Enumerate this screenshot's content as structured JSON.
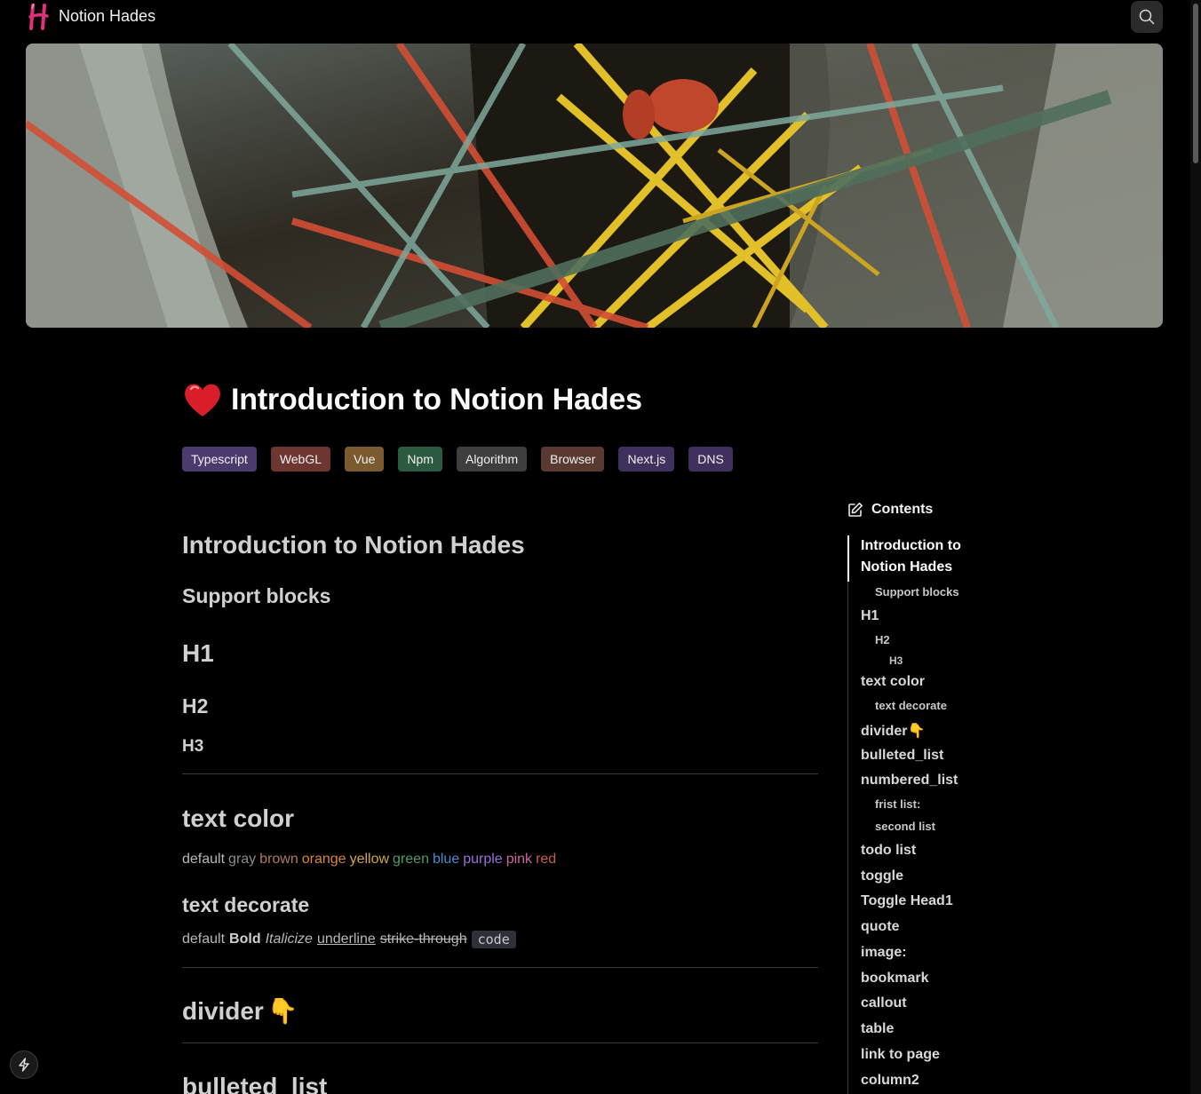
{
  "header": {
    "site_title": "Notion Hades",
    "logo_icon": "hades-h-logo-icon",
    "search_icon": "search-icon"
  },
  "page": {
    "icon": "heart-icon",
    "title": "Introduction to Notion Hades"
  },
  "tags": [
    {
      "label": "Typescript",
      "color": "#4a3a6e"
    },
    {
      "label": "WebGL",
      "color": "#6e3630"
    },
    {
      "label": "Vue",
      "color": "#7a5a2e"
    },
    {
      "label": "Npm",
      "color": "#2c5a41"
    },
    {
      "label": "Algorithm",
      "color": "#3e3e3e"
    },
    {
      "label": "Browser",
      "color": "#5a3a30"
    },
    {
      "label": "Next.js",
      "color": "#40305e"
    },
    {
      "label": "DNS",
      "color": "#40305e"
    }
  ],
  "content": {
    "intro_heading": "Introduction to Notion Hades",
    "support_heading": "Support blocks",
    "h1": "H1",
    "h2": "H2",
    "h3": "H3",
    "text_color_heading": "text color",
    "colors": [
      {
        "label": "default",
        "color": "#b8b8b8"
      },
      {
        "label": "gray",
        "color": "#8a8a8a"
      },
      {
        "label": "brown",
        "color": "#b07a5c"
      },
      {
        "label": "orange",
        "color": "#d9853b"
      },
      {
        "label": "yellow",
        "color": "#d6a73b"
      },
      {
        "label": "green",
        "color": "#4f9a6a"
      },
      {
        "label": "blue",
        "color": "#4b8ad1"
      },
      {
        "label": "purple",
        "color": "#9a6fd6"
      },
      {
        "label": "pink",
        "color": "#c9679c"
      },
      {
        "label": "red",
        "color": "#c65a4c"
      }
    ],
    "text_decorate_heading": "text decorate",
    "decorate": {
      "default": "default",
      "bold": "Bold",
      "italic": "Italicize",
      "underline": "underline",
      "strike": "strike-through",
      "code": "code"
    },
    "divider_heading": "divider",
    "divider_emoji": "👇",
    "bulleted_heading": "bulleted_list"
  },
  "toc": {
    "title": "Contents",
    "title_icon": "edit-icon",
    "items": [
      {
        "label": "Introduction to Notion Hades",
        "level": 1
      },
      {
        "label": "Support blocks",
        "level": 2
      },
      {
        "label": "H1",
        "level": 1
      },
      {
        "label": "H2",
        "level": 2
      },
      {
        "label": "H3",
        "level": 3
      },
      {
        "label": "text color",
        "level": 1
      },
      {
        "label": "text decorate",
        "level": 2
      },
      {
        "label": "divider👇",
        "level": 1
      },
      {
        "label": "bulleted_list",
        "level": 1
      },
      {
        "label": "numbered_list",
        "level": 1
      },
      {
        "label": "frist list:",
        "level": 2
      },
      {
        "label": "second list",
        "level": 2
      },
      {
        "label": "todo list",
        "level": 1
      },
      {
        "label": "toggle",
        "level": 1
      },
      {
        "label": "Toggle Head1",
        "level": 1
      },
      {
        "label": "quote",
        "level": 1
      },
      {
        "label": "image:",
        "level": 1
      },
      {
        "label": "bookmark",
        "level": 1
      },
      {
        "label": "callout",
        "level": 1
      },
      {
        "label": "table",
        "level": 1
      },
      {
        "label": "link to page",
        "level": 1
      },
      {
        "label": "column2",
        "level": 1
      }
    ]
  },
  "footer": {
    "bolt_icon": "lightning-bolt-icon"
  }
}
